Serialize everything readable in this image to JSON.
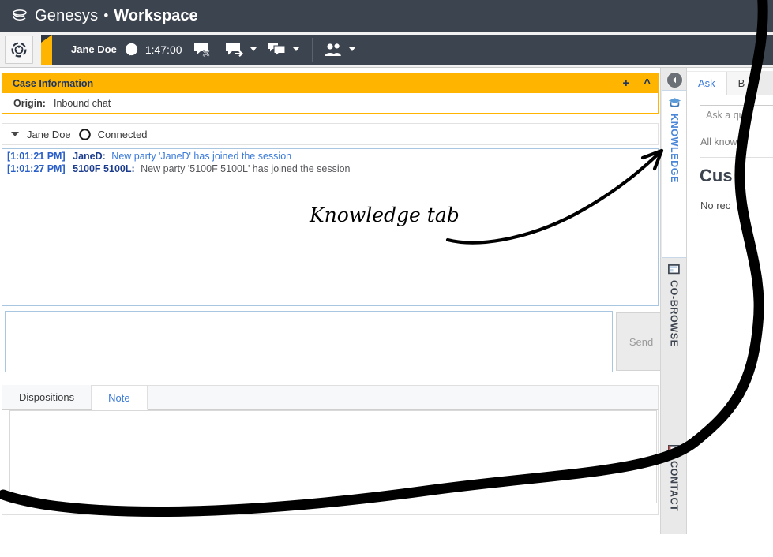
{
  "window": {
    "brand": "Genesys",
    "separator": "•",
    "app_title": "Workspace"
  },
  "toolbar": {
    "workspace_icon": "workspace-target-icon",
    "agent_name": "Jane Doe",
    "media_icon": "chat-bubble-icon",
    "timer": "1:47:00",
    "buttons": [
      {
        "name": "end-chat-button",
        "icon": "chat-end-icon"
      },
      {
        "name": "transfer-chat-button",
        "icon": "chat-transfer-icon"
      },
      {
        "name": "consult-button",
        "icon": "chat-consult-icon"
      },
      {
        "name": "party-action-button",
        "icon": "person-group-icon"
      }
    ]
  },
  "case_information": {
    "title": "Case Information",
    "add_icon": "plus-icon",
    "collapse_icon": "chevron-up-icon",
    "fields": [
      {
        "label": "Origin:",
        "value": "Inbound chat"
      }
    ]
  },
  "party": {
    "collapse_icon": "caret-down-icon",
    "name": "Jane Doe",
    "status_icon": "chat-bubble-icon",
    "state": "Connected"
  },
  "chat": {
    "messages": [
      {
        "time": "[1:01:21 PM]",
        "sender": "JaneD:",
        "text": "New party 'JaneD' has joined the session",
        "muted": false
      },
      {
        "time": "[1:01:27 PM]",
        "sender": "5100F 5100L:",
        "text": "New party '5100F 5100L' has joined the session",
        "muted": true
      }
    ]
  },
  "composer": {
    "value": "",
    "placeholder": "",
    "send_label": "Send",
    "send_enabled": false
  },
  "bottom_tabs": {
    "tabs": [
      {
        "label": "Dispositions",
        "active": false
      },
      {
        "label": "Note",
        "active": true
      }
    ],
    "note_value": ""
  },
  "tab_rail": {
    "collapse_icon": "collapse-left-icon",
    "tabs": [
      {
        "label": "KNOWLEDGE",
        "icon": "graduation-cap-icon",
        "active": true
      },
      {
        "label": "CO-BROWSE",
        "icon": "cobrowse-window-icon",
        "active": false
      },
      {
        "label": "CONTACT",
        "icon": "contact-card-icon",
        "active": false
      }
    ]
  },
  "right_panel": {
    "tabs": [
      {
        "label": "Ask",
        "active": true
      },
      {
        "label": "B",
        "active": false
      }
    ],
    "search_placeholder": "Ask a que",
    "filter_label": "All know",
    "heading": "Cus",
    "empty_text": "No rec"
  },
  "annotation": {
    "text": "Knowledge tab",
    "arrow": "curved-arrow-to-knowledge-tab"
  },
  "colors": {
    "title_bar": "#3c4450",
    "accent_orange": "#ffb400",
    "link_blue": "#3a7ad9",
    "active_tab_blue": "#4a86d8"
  }
}
